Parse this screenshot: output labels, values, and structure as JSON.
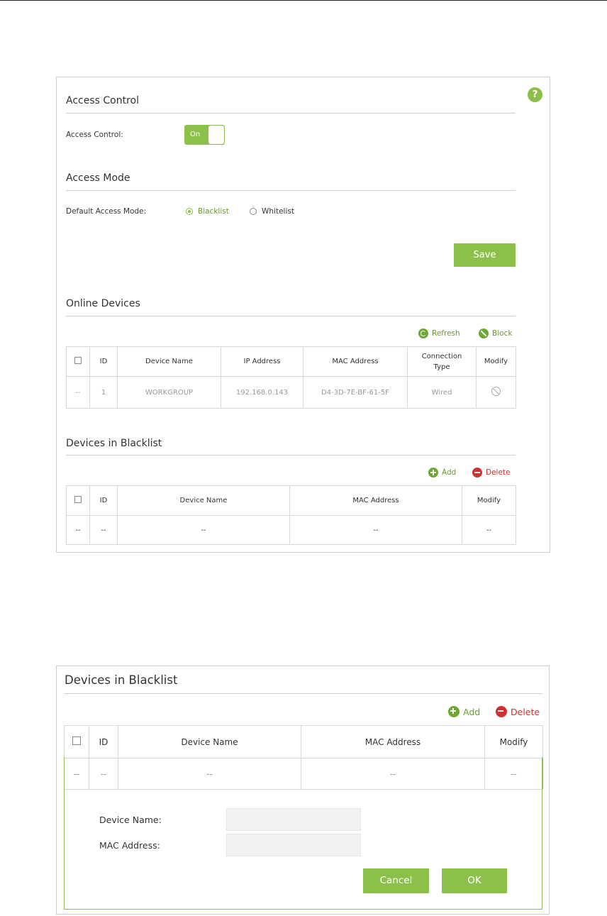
{
  "access_control": {
    "section_title": "Access Control",
    "label": "Access Control:",
    "toggle_label": "On"
  },
  "access_mode": {
    "section_title": "Access Mode",
    "label": "Default Access Mode:",
    "options": [
      "Blacklist",
      "Whitelist"
    ],
    "selected": "Blacklist"
  },
  "save_label": "Save",
  "help_symbol": "?",
  "online_devices": {
    "section_title": "Online Devices",
    "refresh_label": "Refresh",
    "block_label": "Block",
    "columns": [
      "ID",
      "Device Name",
      "IP Address",
      "MAC Address",
      "Connection Type",
      "Modify"
    ],
    "rows": [
      {
        "select": "--",
        "id": "1",
        "device_name": "WORKGROUP",
        "ip": "192.168.0.143",
        "mac": "D4-3D-7E-BF-61-5F",
        "type": "Wired"
      }
    ]
  },
  "blacklist": {
    "section_title": "Devices in Blacklist",
    "add_label": "Add",
    "delete_label": "Delete",
    "columns": [
      "ID",
      "Device Name",
      "MAC Address",
      "Modify"
    ],
    "rows": [
      {
        "select": "--",
        "id": "--",
        "device_name": "--",
        "mac": "--",
        "modify": "--"
      }
    ]
  },
  "blacklist_edit": {
    "section_title": "Devices in Blacklist",
    "add_label": "Add",
    "delete_label": "Delete",
    "columns": [
      "ID",
      "Device Name",
      "MAC Address",
      "Modify"
    ],
    "rows": [
      {
        "select": "--",
        "id": "--",
        "device_name": "--",
        "mac": "--",
        "modify": "--"
      }
    ],
    "device_name_label": "Device Name:",
    "device_name_value": "",
    "mac_label": "MAC Address:",
    "mac_value": "",
    "cancel_label": "Cancel",
    "ok_label": "OK"
  },
  "colors": {
    "accent": "#8dc04a",
    "delete": "#d0312d"
  }
}
